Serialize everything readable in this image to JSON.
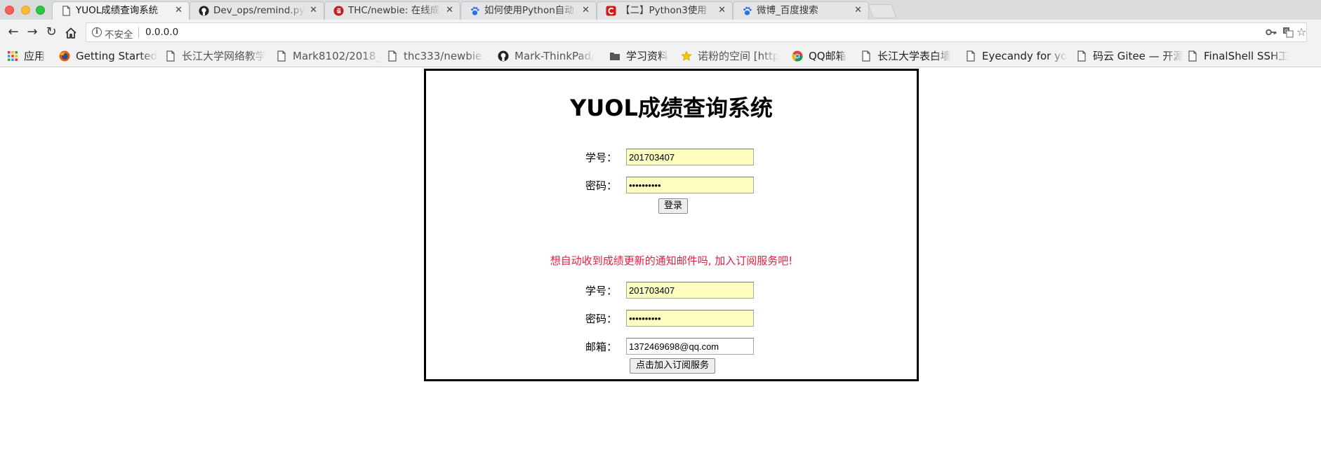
{
  "tabs": [
    {
      "title": "YUOL成绩查询系统",
      "icon": "page-icon",
      "active": true
    },
    {
      "title": "Dev_ops/remind.py",
      "icon": "github-icon",
      "active": false
    },
    {
      "title": "THC/newbie: 在线成",
      "icon": "gitee-icon",
      "active": false
    },
    {
      "title": "如何使用Python自动",
      "icon": "baidu-paw-icon",
      "active": false
    },
    {
      "title": "【二】Python3使用",
      "icon": "csdn-icon",
      "active": false
    },
    {
      "title": "微博_百度搜索",
      "icon": "baidu-paw-icon",
      "active": false
    }
  ],
  "address_bar": {
    "security_label": "不安全",
    "url": "0.0.0.0"
  },
  "bookmarks": [
    {
      "label": "应用",
      "icon": "apps-grid-icon"
    },
    {
      "label": "Getting Started",
      "icon": "firefox-icon"
    },
    {
      "label": "长江大学网络教学",
      "icon": "page-icon"
    },
    {
      "label": "Mark8102/2018_",
      "icon": "page-icon"
    },
    {
      "label": "thc333/newbie:",
      "icon": "page-icon"
    },
    {
      "label": "Mark-ThinkPad/",
      "icon": "github-icon"
    },
    {
      "label": "学习资料",
      "icon": "folder-icon"
    },
    {
      "label": "诺粉的空间 [http",
      "icon": "star-icon"
    },
    {
      "label": "QQ邮箱",
      "icon": "chrome-icon"
    },
    {
      "label": "长江大学表白墙",
      "icon": "page-icon"
    },
    {
      "label": "Eyecandy for yo",
      "icon": "page-icon"
    },
    {
      "label": "码云 Gitee — 开源",
      "icon": "page-icon"
    },
    {
      "label": "FinalShell SSH工",
      "icon": "page-icon"
    }
  ],
  "page": {
    "title": "YUOL成绩查询系统",
    "login": {
      "student_id_label": "学号：",
      "student_id_value": "201703407",
      "password_label": "密码：",
      "password_value": "••••••••••",
      "submit_label": "登录"
    },
    "subscribe": {
      "notice": "想自动收到成绩更新的通知邮件吗, 加入订阅服务吧!",
      "student_id_label": "学号：",
      "student_id_value": "201703407",
      "password_label": "密码：",
      "password_value": "••••••••••",
      "email_label": "邮箱：",
      "email_value": "1372469698@qq.com",
      "submit_label": "点击加入订阅服务"
    }
  },
  "colors": {
    "autofill_bg": "#fdfdbf",
    "notice": "#e02040"
  }
}
